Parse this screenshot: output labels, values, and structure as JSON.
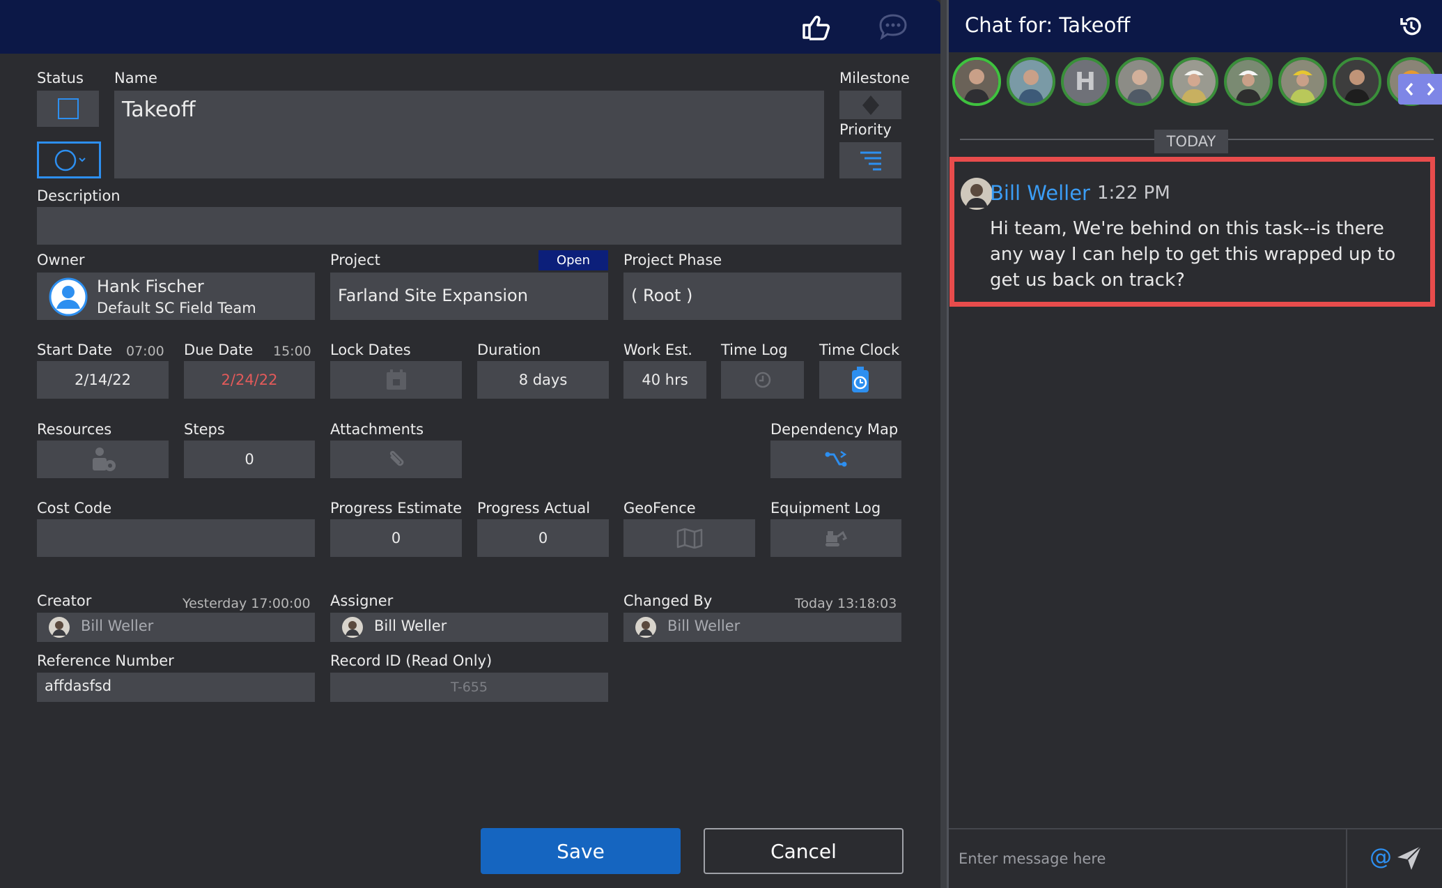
{
  "task": {
    "status_label": "Status",
    "name_label": "Name",
    "name_value": "Takeoff",
    "milestone_label": "Milestone",
    "priority_label": "Priority",
    "description_label": "Description",
    "description_value": "",
    "owner": {
      "label": "Owner",
      "name": "Hank Fischer",
      "team": "Default SC Field Team"
    },
    "project": {
      "label": "Project",
      "badge": "Open",
      "value": "Farland Site Expansion"
    },
    "project_phase": {
      "label": "Project Phase",
      "value": "( Root )"
    },
    "start_date": {
      "label": "Start Date",
      "time": "07:00",
      "value": "2/14/22"
    },
    "due_date": {
      "label": "Due Date",
      "time": "15:00",
      "value": "2/24/22"
    },
    "lock_dates": {
      "label": "Lock Dates"
    },
    "duration": {
      "label": "Duration",
      "value": "8 days"
    },
    "work_est": {
      "label": "Work Est.",
      "value": "40 hrs"
    },
    "time_log": {
      "label": "Time Log"
    },
    "time_clock": {
      "label": "Time Clock"
    },
    "resources": {
      "label": "Resources"
    },
    "steps": {
      "label": "Steps",
      "value": "0"
    },
    "attachments": {
      "label": "Attachments"
    },
    "dependency_map": {
      "label": "Dependency Map"
    },
    "cost_code": {
      "label": "Cost Code",
      "value": ""
    },
    "progress_estimate": {
      "label": "Progress Estimate",
      "value": "0"
    },
    "progress_actual": {
      "label": "Progress Actual",
      "value": "0"
    },
    "geofence": {
      "label": "GeoFence"
    },
    "equipment_log": {
      "label": "Equipment Log"
    },
    "creator": {
      "label": "Creator",
      "when": "Yesterday  17:00:00",
      "value": "Bill Weller"
    },
    "assigner": {
      "label": "Assigner",
      "value": "Bill Weller"
    },
    "changed_by": {
      "label": "Changed By",
      "when": "Today  13:18:03",
      "value": "Bill Weller"
    },
    "reference_number": {
      "label": "Reference Number",
      "value": "affdasfsd"
    },
    "record_id": {
      "label": "Record ID (Read Only)",
      "value": "T-655"
    },
    "save_label": "Save",
    "cancel_label": "Cancel"
  },
  "chat": {
    "title": "Chat for: Takeoff",
    "avatar_initial": "H",
    "day_separator": "TODAY",
    "messages": [
      {
        "author": "Bill Weller",
        "time": "1:22 PM",
        "text": "Hi team, We're behind on this task--is there any way I can help to get this wrapped up to get us back on track?"
      }
    ],
    "input_placeholder": "Enter message here",
    "mention_symbol": "@"
  },
  "colors": {
    "topbar": "#0c1847",
    "field": "#45474d",
    "accent_blue": "#2d8ff0",
    "save_blue": "#1565c0",
    "due_red": "#e35a5a",
    "highlight_red": "#e84c4c",
    "author_blue": "#3b9df5"
  },
  "icons": [
    "thumbs-up-icon",
    "comment-icon",
    "history-icon",
    "send-icon",
    "milestone-diamond-icon",
    "priority-filter-icon",
    "calendar-lock-icon",
    "clock-icon",
    "stopwatch-icon",
    "resources-icon",
    "paperclip-icon",
    "dependency-map-icon",
    "map-icon",
    "excavator-icon",
    "user-icon"
  ]
}
